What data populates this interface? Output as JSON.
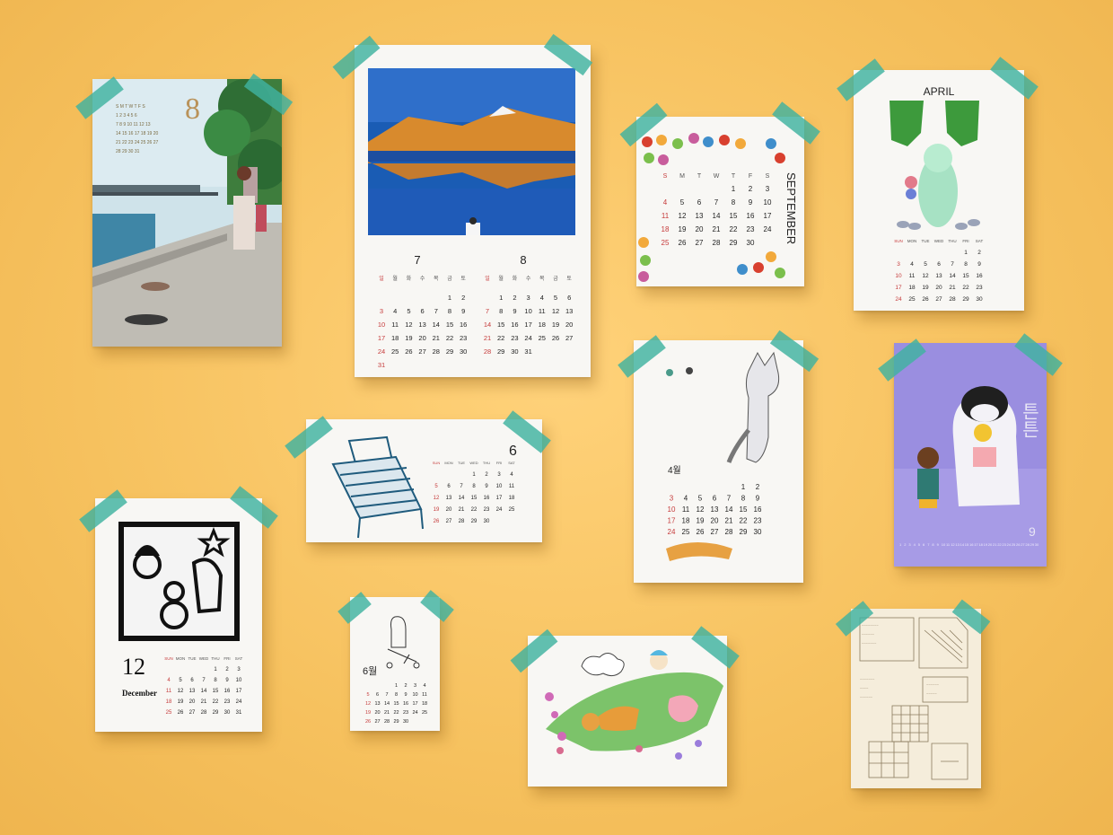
{
  "scene": "calendar-collage",
  "colors": {
    "background": "#f7c463",
    "tape": "#40b2a0",
    "paper": "#f8f7f4",
    "sunday_red": "#c63b3b"
  },
  "cards": {
    "river": {
      "month_label": "8"
    },
    "lake": {
      "left_month": "7",
      "right_month": "8",
      "weekday_headers": [
        "일",
        "월",
        "화",
        "수",
        "목",
        "금",
        "토"
      ],
      "july_rows": [
        [
          "",
          "",
          "",
          "",
          "",
          "1",
          "2"
        ],
        [
          "3",
          "4",
          "5",
          "6",
          "7",
          "8",
          "9"
        ],
        [
          "10",
          "11",
          "12",
          "13",
          "14",
          "15",
          "16"
        ],
        [
          "17",
          "18",
          "19",
          "20",
          "21",
          "22",
          "23"
        ],
        [
          "24",
          "25",
          "26",
          "27",
          "28",
          "29",
          "30"
        ],
        [
          "31",
          "",
          "",
          "",
          "",
          "",
          ""
        ]
      ],
      "august_rows": [
        [
          "",
          "1",
          "2",
          "3",
          "4",
          "5",
          "6"
        ],
        [
          "7",
          "8",
          "9",
          "10",
          "11",
          "12",
          "13"
        ],
        [
          "14",
          "15",
          "16",
          "17",
          "18",
          "19",
          "20"
        ],
        [
          "21",
          "22",
          "23",
          "24",
          "25",
          "26",
          "27"
        ],
        [
          "28",
          "29",
          "30",
          "31",
          "",
          "",
          ""
        ]
      ]
    },
    "september": {
      "month_name": "SEPTEMBER",
      "weekday_headers": [
        "S",
        "M",
        "T",
        "W",
        "T",
        "F",
        "S"
      ],
      "rows": [
        [
          "",
          "",
          "",
          "",
          "1",
          "2",
          "3"
        ],
        [
          "4",
          "5",
          "6",
          "7",
          "8",
          "9",
          "10"
        ],
        [
          "11",
          "12",
          "13",
          "14",
          "15",
          "16",
          "17"
        ],
        [
          "18",
          "19",
          "20",
          "21",
          "22",
          "23",
          "24"
        ],
        [
          "25",
          "26",
          "27",
          "28",
          "29",
          "30",
          ""
        ]
      ]
    },
    "april": {
      "month_name": "APRIL",
      "weekday_headers": [
        "SUN",
        "MON",
        "TUE",
        "WED",
        "THU",
        "FRI",
        "SAT"
      ],
      "rows": [
        [
          "",
          "",
          "",
          "",
          "",
          "1",
          "2"
        ],
        [
          "3",
          "4",
          "5",
          "6",
          "7",
          "8",
          "9"
        ],
        [
          "10",
          "11",
          "12",
          "13",
          "14",
          "15",
          "16"
        ],
        [
          "17",
          "18",
          "19",
          "20",
          "21",
          "22",
          "23"
        ],
        [
          "24",
          "25",
          "26",
          "27",
          "28",
          "29",
          "30"
        ]
      ]
    },
    "bench": {
      "month_label": "6",
      "weekday_headers": [
        "SUN",
        "MON",
        "TUE",
        "WED",
        "THU",
        "FRI",
        "SAT"
      ],
      "rows": [
        [
          "",
          "",
          "",
          "1",
          "2",
          "3",
          "4"
        ],
        [
          "5",
          "6",
          "7",
          "8",
          "9",
          "10",
          "11"
        ],
        [
          "12",
          "13",
          "14",
          "15",
          "16",
          "17",
          "18"
        ],
        [
          "19",
          "20",
          "21",
          "22",
          "23",
          "24",
          "25"
        ],
        [
          "26",
          "27",
          "28",
          "29",
          "30",
          "",
          ""
        ]
      ]
    },
    "cat": {
      "month_label": "4월",
      "rows": [
        [
          "",
          "",
          "",
          "",
          "",
          "1",
          "2"
        ],
        [
          "3",
          "4",
          "5",
          "6",
          "7",
          "8",
          "9"
        ],
        [
          "10",
          "11",
          "12",
          "13",
          "14",
          "15",
          "16"
        ],
        [
          "17",
          "18",
          "19",
          "20",
          "21",
          "22",
          "23"
        ],
        [
          "24",
          "25",
          "26",
          "27",
          "28",
          "29",
          "30"
        ]
      ]
    },
    "purple": {
      "month_label": "9",
      "side_text": "튼튼"
    },
    "december": {
      "day_number": "12",
      "month_name": "December",
      "weekday_headers": [
        "SUN",
        "MON",
        "TUE",
        "WED",
        "THU",
        "FRI",
        "SAT"
      ],
      "rows": [
        [
          "",
          "",
          "",
          "",
          "1",
          "2",
          "3"
        ],
        [
          "4",
          "5",
          "6",
          "7",
          "8",
          "9",
          "10"
        ],
        [
          "11",
          "12",
          "13",
          "14",
          "15",
          "16",
          "17"
        ],
        [
          "18",
          "19",
          "20",
          "21",
          "22",
          "23",
          "24"
        ],
        [
          "25",
          "26",
          "27",
          "28",
          "29",
          "30",
          "31"
        ]
      ]
    },
    "small_june": {
      "month_label": "6월",
      "rows": [
        [
          "",
          "",
          "",
          "1",
          "2",
          "3",
          "4"
        ],
        [
          "5",
          "6",
          "7",
          "8",
          "9",
          "10",
          "11"
        ],
        [
          "12",
          "13",
          "14",
          "15",
          "16",
          "17",
          "18"
        ],
        [
          "19",
          "20",
          "21",
          "22",
          "23",
          "24",
          "25"
        ],
        [
          "26",
          "27",
          "28",
          "29",
          "30",
          "",
          ""
        ]
      ]
    },
    "garden": {},
    "sketch": {}
  }
}
